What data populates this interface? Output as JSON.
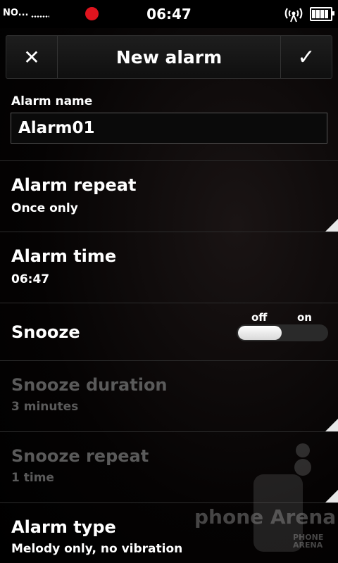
{
  "status_bar": {
    "operator": "NO...",
    "time": "06:47",
    "icons": [
      "signal-icon",
      "recording-icon",
      "wireless-icon",
      "battery-icon"
    ]
  },
  "title_bar": {
    "title": "New alarm",
    "close_glyph": "✕",
    "confirm_glyph": "✓"
  },
  "alarm_name": {
    "label": "Alarm name",
    "value": "Alarm01"
  },
  "rows": {
    "repeat": {
      "title": "Alarm repeat",
      "value": "Once only"
    },
    "time": {
      "title": "Alarm time",
      "value": "06:47"
    },
    "snooze": {
      "title": "Snooze",
      "toggle_off_label": "off",
      "toggle_on_label": "on",
      "state": "off"
    },
    "snooze_duration": {
      "title": "Snooze duration",
      "value": "3 minutes",
      "enabled": false
    },
    "snooze_repeat": {
      "title": "Snooze repeat",
      "value": "1 time",
      "enabled": false
    },
    "alarm_type": {
      "title": "Alarm type",
      "value": "Melody only, no vibration"
    }
  },
  "watermark": {
    "text": "phone Arena",
    "small_line1": "PHONE",
    "small_line2": "ARENA"
  },
  "colors": {
    "background": "#000000",
    "accent_record": "#e0141e",
    "disabled_text": "#5a5a5a"
  }
}
